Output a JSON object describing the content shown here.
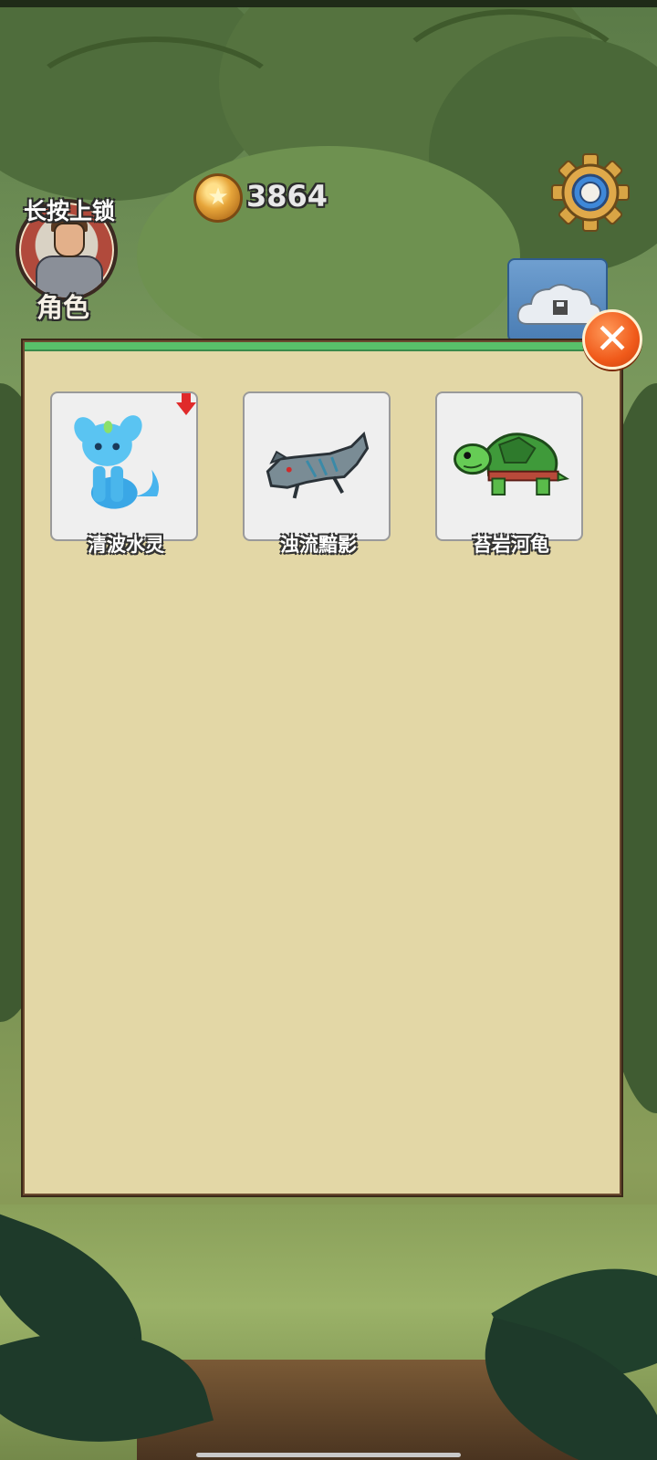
{
  "hud": {
    "lock_hint": "长按上锁",
    "role_label": "角色",
    "coin_count": "3864",
    "settings_icon": "gear-icon",
    "cloud_save_icon": "cloud-save-icon"
  },
  "panel": {
    "close_icon": "close-icon",
    "accent_color": "#58c06a",
    "pets": [
      {
        "name": "清波水灵",
        "icon": "water-spirit-icon",
        "badge": "red-down-arrow-icon"
      },
      {
        "name": "浊流黯影",
        "icon": "shadow-wolf-icon"
      },
      {
        "name": "苔岩河龟",
        "icon": "moss-turtle-icon"
      }
    ]
  },
  "colors": {
    "panel_bg": "#e3d7a6",
    "close_button": "#f05a1a",
    "card_bg": "#efefef"
  }
}
